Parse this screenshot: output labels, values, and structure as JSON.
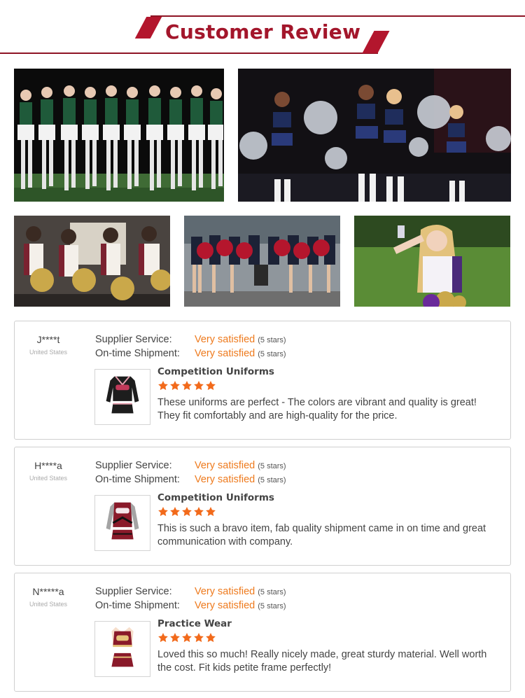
{
  "header": {
    "title": "Customer Review"
  },
  "reviews": [
    {
      "name": "J****t",
      "country": "United States",
      "supplier_label": "Supplier Service:",
      "supplier_value": "Very satisfied",
      "supplier_stars": "(5 stars)",
      "shipment_label": "On-time Shipment:",
      "shipment_value": "Very satisfied",
      "shipment_stars": "(5 stars)",
      "product": "Competition Uniforms",
      "rating": 5,
      "comment": "These uniforms are perfect - The colors are vibrant and quality is great! They fit comfortably and are high-quality for the price."
    },
    {
      "name": "H****a",
      "country": "United States",
      "supplier_label": "Supplier Service:",
      "supplier_value": "Very satisfied",
      "supplier_stars": "(5 stars)",
      "shipment_label": "On-time Shipment:",
      "shipment_value": "Very satisfied",
      "shipment_stars": "(5 stars)",
      "product": "Competition Uniforms",
      "rating": 5,
      "comment": "This is such a bravo item, fab quality shipment came in on time and great communication with company."
    },
    {
      "name": "N*****a",
      "country": "United States",
      "supplier_label": "Supplier Service:",
      "supplier_value": "Very satisfied",
      "supplier_stars": "(5 stars)",
      "shipment_label": "On-time Shipment:",
      "shipment_value": "Very satisfied",
      "shipment_stars": "(5 stars)",
      "product": "Practice Wear",
      "rating": 5,
      "comment": "Loved this so much! Really nicely made, great sturdy material. Well worth the cost. Fit kids petite frame perfectly!"
    }
  ],
  "colors": {
    "brand": "#a3162b",
    "accent": "#ee7a1d",
    "star": "#f26a1b"
  },
  "icons": {
    "star": "star-icon"
  }
}
